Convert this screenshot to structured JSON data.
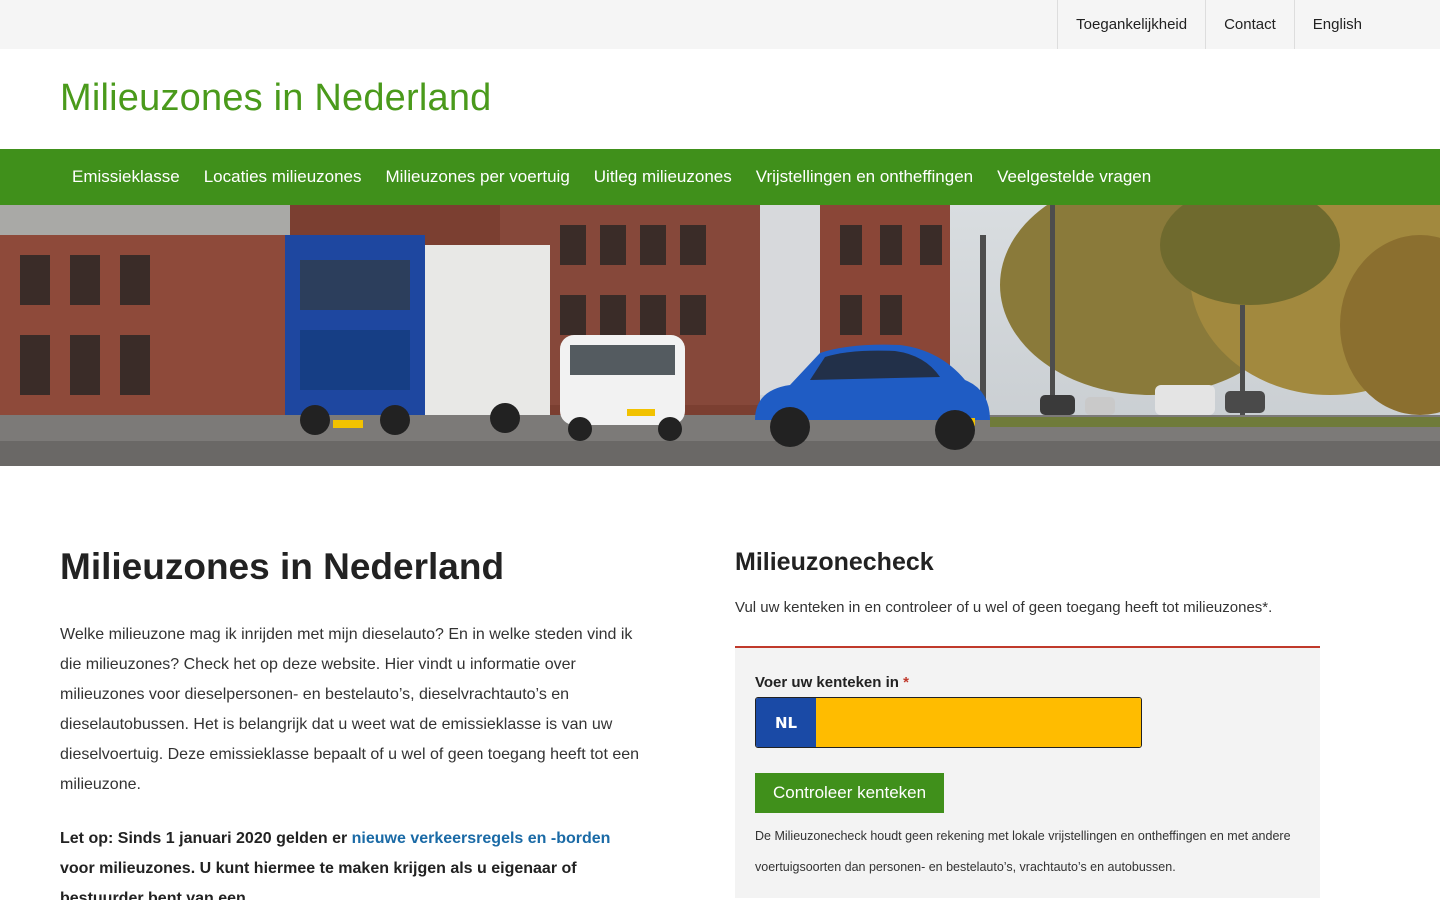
{
  "topbar": {
    "links": [
      "Toegankelijkheid",
      "Contact",
      "English"
    ]
  },
  "header": {
    "site_title": "Milieuzones in Nederland"
  },
  "nav": {
    "items": [
      "Emissieklasse",
      "Locaties milieuzones",
      "Milieuzones per voertuig",
      "Uitleg milieuzones",
      "Vrijstellingen en ontheffingen",
      "Veelgestelde vragen"
    ]
  },
  "main": {
    "title": "Milieuzones in Nederland",
    "intro": "Welke milieuzone mag ik inrijden met mijn dieselauto?  En in welke steden vind ik die milieuzones? Check het op deze website. Hier vindt u informatie over milieuzones voor dieselpersonen- en bestelauto’s, dieselvrachtauto’s en dieselautobussen. Het is belangrijk dat u weet wat de emissieklasse is van uw dieselvoertuig. Deze emissieklasse bepaalt of u wel of geen toegang heeft tot een milieuzone.",
    "notice_before": "Let op: Sinds 1 januari 2020 gelden er ",
    "notice_link": "nieuwe verkeersregels en -borden",
    "notice_after": " voor milieuzones. U kunt hiermee te maken krijgen als u eigenaar of bestuurder bent van een"
  },
  "check": {
    "title": "Milieuzonecheck",
    "subtitle": "Vul uw kenteken in en controleer of u wel of geen toegang heeft tot milieuzones*.",
    "plate_label": "Voer uw kenteken in",
    "required_mark": "*",
    "country_code": "NL",
    "plate_value": "",
    "button_label": "Controleer kenteken",
    "disclaimer": "De Milieuzonecheck houdt geen rekening met lokale vrijstellingen en ontheffingen en met andere voertuigsoorten dan personen- en bestelauto’s, vrachtauto’s en autobussen."
  },
  "colors": {
    "brand_green": "#40901b",
    "title_green": "#4a9a1b",
    "link_blue": "#1a6aa6",
    "plate_yellow": "#ffbc00",
    "plate_blue": "#1a4aa6",
    "accent_red": "#c0392b"
  }
}
